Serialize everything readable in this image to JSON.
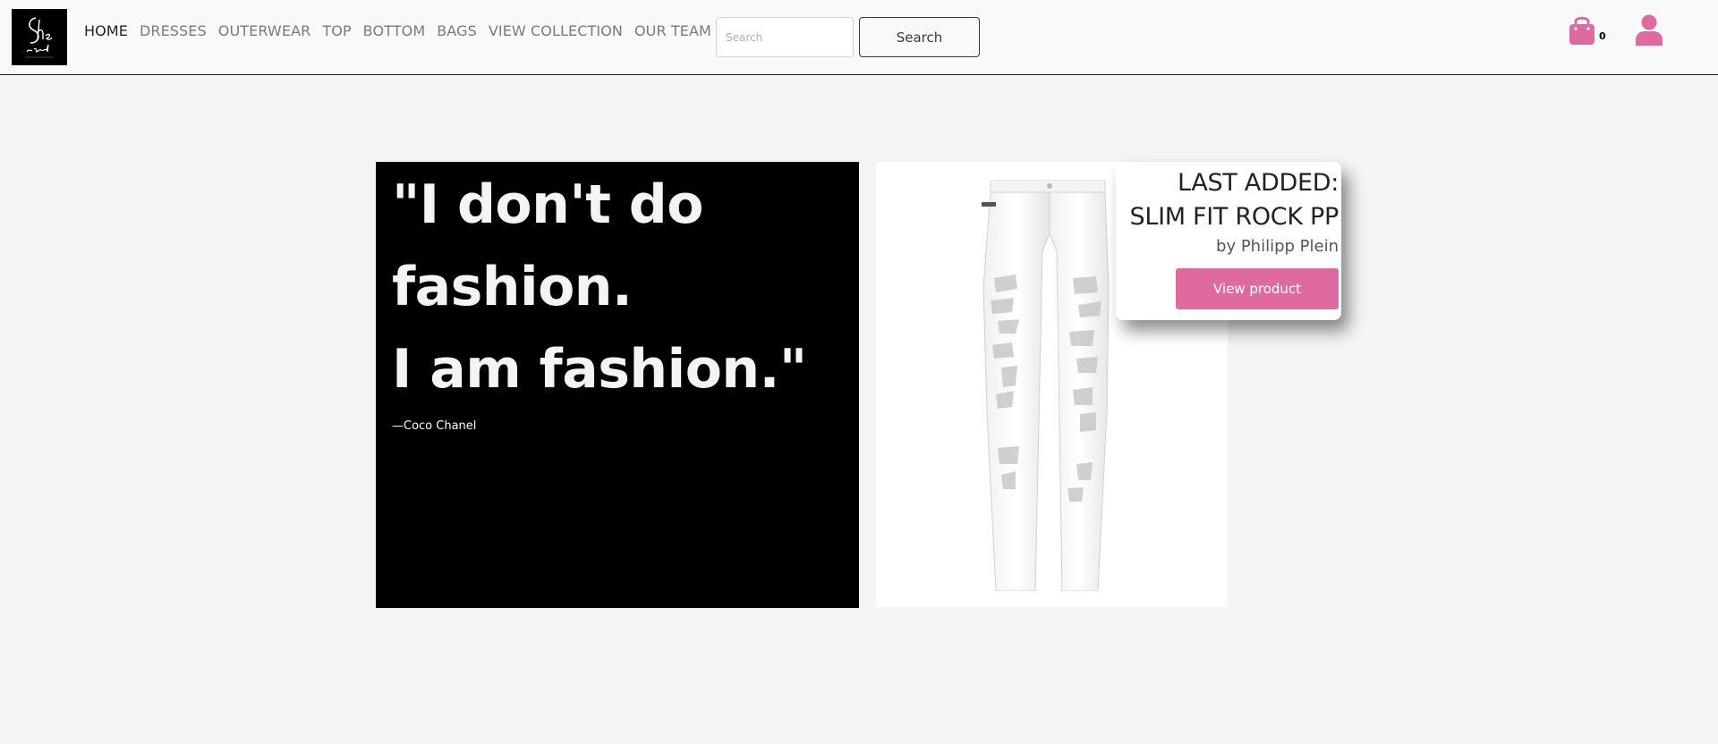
{
  "app": {
    "logo_text": "She said"
  },
  "nav": {
    "items": [
      {
        "label": "HOME",
        "active": true
      },
      {
        "label": "DRESSES"
      },
      {
        "label": "OUTERWEAR"
      },
      {
        "label": "TOP"
      },
      {
        "label": "BOTTOM"
      },
      {
        "label": "BAGS"
      },
      {
        "label": "VIEW COLLECTION"
      },
      {
        "label": "OUR TEAM"
      }
    ]
  },
  "search": {
    "placeholder": "Search",
    "value": "",
    "button_label": "Search"
  },
  "cart": {
    "count": "0",
    "icon": "shopping-bag-icon"
  },
  "user": {
    "icon": "user-icon"
  },
  "quote": {
    "lines": [
      "\"I don't do",
      "fashion.",
      "I am fashion.\""
    ],
    "author": "—Coco Chanel"
  },
  "last_added": {
    "heading": "LAST ADDED:",
    "product_name": "SLIM FIT ROCK PP",
    "brand": "by Philipp Plein",
    "button_label": "View product"
  },
  "colors": {
    "accent": "#df6aa0",
    "navbar_bg": "#f8f9fa",
    "page_bg": "#f4f4f4",
    "quote_bg": "#000000"
  }
}
